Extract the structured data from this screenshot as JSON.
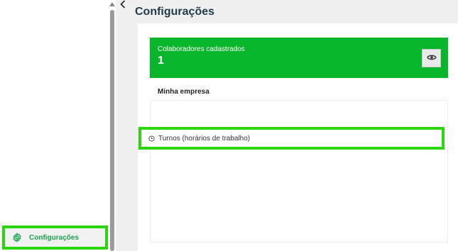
{
  "sidebar": {
    "items": [
      {
        "label": "Configurações",
        "icon": "gear-icon",
        "active": true
      }
    ]
  },
  "header": {
    "title": "Configurações"
  },
  "stat_card": {
    "label": "Colaboradores cadastrados",
    "value": "1",
    "action_icon": "eye-icon",
    "color": "#09b52b"
  },
  "company": {
    "section_title": "Minha empresa",
    "items": [
      {
        "label": "Turnos (horários de trabalho)",
        "icon": "clock-icon"
      }
    ]
  },
  "colors": {
    "highlight": "#2bd70c",
    "active_text": "#17a44a",
    "title": "#1e3a4b"
  }
}
